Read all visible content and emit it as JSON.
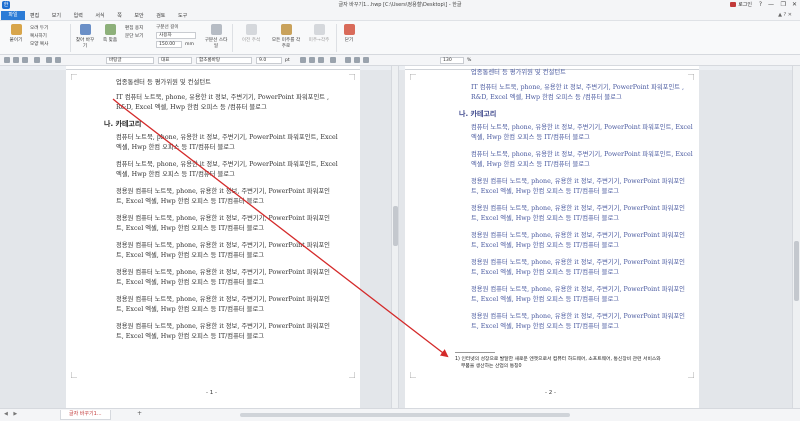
{
  "window": {
    "title": "글자 바꾸기1...hwp [C:\\Users\\정용철\\Desktop\\] - 한글",
    "app_logo": "한",
    "login_label": "로그인",
    "controls": [
      "?",
      "—",
      "❐",
      "✕"
    ]
  },
  "menu": {
    "file_label": "파일",
    "items": [
      "편집",
      "보기",
      "입력",
      "서식",
      "쪽",
      "보안",
      "검토",
      "도구"
    ],
    "right_icons": "▲ ? ✕"
  },
  "ribbon": {
    "clipboard": {
      "paste": "붙이기",
      "cut": "오려 두기",
      "copy": "복사하기",
      "format_copy": "모양 복사"
    },
    "find_replace": "찾아 바꾸기",
    "zoom_label": "쪽 맞춤",
    "edit_copy": "편집 용지",
    "spacing_label": "문단 보기",
    "page_width": "구분선 길이",
    "unit": "사용자",
    "value": "150.00",
    "unit_mm": "mm",
    "divider_style": "구분선 스타일",
    "prev_note": "이전 주석",
    "next_note": "다음 주석",
    "all_notes": "모든 미주를 각주로",
    "all_footnotes": "미주→각주",
    "close": "닫기"
  },
  "format": {
    "style": "바탕글",
    "lang": "대표",
    "font": "함초롬바탕",
    "size": "9.0",
    "unit": "pt",
    "zoom": "130",
    "zoom_unit": "%"
  },
  "page1": {
    "intro_line": "업종통센터 등 평가위원 및 컨설턴트",
    "intro_para": [
      "IT 컴퓨터 노트북, phone, 유용한 it 정보, 주변기기, PowerPoint 파워포인트 ,",
      "R&D, Excel 엑셀, Hwp 한컴 오피스 등 /컴퓨터 블로그"
    ],
    "heading": "나. 카테고리",
    "paras": [
      [
        "컴퓨터 노트북, phone, 유용한 it 정보, 주변기기, PowerPoint 파워포인트, Excel",
        "엑셀, Hwp 한컴 오피스 등 IT/컴퓨터 블로그"
      ],
      [
        "컴퓨터 노트북, phone, 유용한 it 정보, 주변기기, PowerPoint 파워포인트, Excel",
        "엑셀, Hwp 한컴 오피스 등 IT/컴퓨터 블로그"
      ],
      [
        "정용원 컴퓨터 노트북, phone, 유용한 it 정보, 주변기기, PowerPoint 파워포인",
        "트, Excel 엑셀, Hwp 한컴 오피스 등 IT/컴퓨터 블로그"
      ],
      [
        "정용원 컴퓨터 노트북, phone, 유용한 it 정보, 주변기기, PowerPoint 파워포인",
        "트, Excel 엑셀, Hwp 한컴 오피스 등 IT/컴퓨터 블로그"
      ],
      [
        "정용원 컴퓨터 노트북, phone, 유용한 it 정보, 주변기기, PowerPoint 파워포인",
        "트, Excel 엑셀, Hwp 한컴 오피스 등 IT/컴퓨터 블로그"
      ],
      [
        "정용원 컴퓨터 노트북, phone, 유용한 it 정보, 주변기기, PowerPoint 파워포인",
        "트, Excel 엑셀, Hwp 한컴 오피스 등 IT/컴퓨터 블로그"
      ],
      [
        "정용원 컴퓨터 노트북, phone, 유용한 it 정보, 주변기기, PowerPoint 파워포인",
        "트, Excel 엑셀, Hwp 한컴 오피스 등 IT/컴퓨터 블로그"
      ],
      [
        "정용원 컴퓨터 노트북, phone, 유용한 it 정보, 주변기기, PowerPoint 파워포인",
        "트, Excel 엑셀, Hwp 한컴 오피스 등 IT/컴퓨터 블로그"
      ]
    ],
    "page_number": "- 1 -"
  },
  "page2": {
    "intro_line": "업종통센터 등 평가위원 및 컨설턴트",
    "intro_para": [
      "IT 컴퓨터 노트북, phone, 유용한 it 정보, 주변기기, PowerPoint 파워포인트 ,",
      "R&D, Excel 엑셀, Hwp 한컴 오피스 등 /컴퓨터 블로그"
    ],
    "heading": "나. 카테고리",
    "paras": [
      [
        "컴퓨터 노트북, phone, 유용한 it 정보, 주변기기, PowerPoint 파워포인트, Excel",
        "엑셀, Hwp 한컴 오피스 등 IT/컴퓨터 블로그"
      ],
      [
        "컴퓨터 노트북, phone, 유용한 it 정보, 주변기기, PowerPoint 파워포인트, Excel",
        "엑셀, Hwp 한컴 오피스 등 IT/컴퓨터 블로그"
      ],
      [
        "정용원 컴퓨터 노트북, phone, 유용한 it 정보, 주변기기, PowerPoint 파워포인",
        "트, Excel 엑셀, Hwp 한컴 오피스 등 IT/컴퓨터 블로그"
      ],
      [
        "정용원 컴퓨터 노트북, phone, 유용한 it 정보, 주변기기, PowerPoint 파워포인",
        "트, Excel 엑셀, Hwp 한컴 오피스 등 IT/컴퓨터 블로그"
      ],
      [
        "정용원 컴퓨터 노트북, phone, 유용한 it 정보, 주변기기, PowerPoint 파워포인",
        "트, Excel 엑셀, Hwp 한컴 오피스 등 IT/컴퓨터 블로그"
      ],
      [
        "정용원 컴퓨터 노트북, phone, 유용한 it 정보, 주변기기, PowerPoint 파워포인",
        "트, Excel 엑셀, Hwp 한컴 오피스 등 IT/컴퓨터 블로그"
      ],
      [
        "정용원 컴퓨터 노트북, phone, 유용한 it 정보, 주변기기, PowerPoint 파워포인",
        "트, Excel 엑셀, Hwp 한컴 오피스 등 IT/컴퓨터 블로그"
      ],
      [
        "정용원 컴퓨터 노트북, phone, 유용한 it 정보, 주변기기, PowerPoint 파워포인",
        "트, Excel 엑셀, Hwp 한컴 오피스 등 IT/컴퓨터 블로그"
      ]
    ],
    "footnote": [
      "1) 인터넷의 성장으로 발달한 새로운 엔젯으로서 컴퓨터 하드웨어, 소프트웨어, 통신장비 관련 서비스와",
      "부품을 생산하는 산업의 통칭0"
    ],
    "page_number": "- 2 -"
  },
  "tabs": {
    "nav": "◀ ▶",
    "active": "글자 바꾸기1...",
    "add": "+"
  },
  "colors": {
    "arrow": "#d42a2a",
    "accent": "#2b7bd6",
    "page2_text": "#4a5aa0"
  }
}
